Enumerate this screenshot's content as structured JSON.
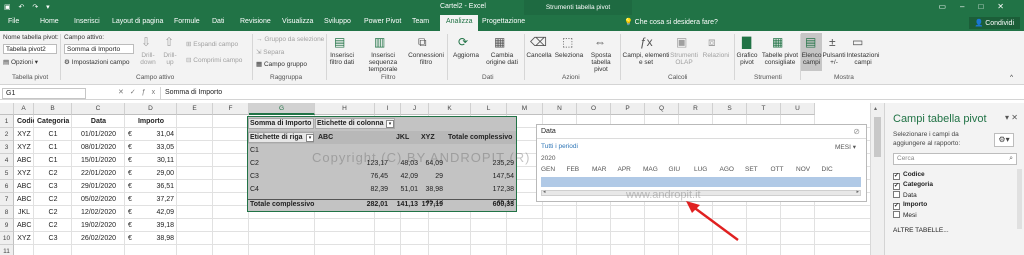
{
  "app": {
    "document_title": "Cartel2 - Excel",
    "contextual_tab_group": "Strumenti tabella pivot",
    "tell_me": "Che cosa si desidera fare?",
    "share": "Condividi",
    "accent": "#217346"
  },
  "tabs": [
    "File",
    "Home",
    "Inserisci",
    "Layout di pagina",
    "Formule",
    "Dati",
    "Revisione",
    "Visualizza",
    "Sviluppo",
    "Power Pivot",
    "Team",
    "Analizza",
    "Progettazione"
  ],
  "active_tab": "Analizza",
  "ribbon": {
    "pivot_name_label": "Nome tabella pivot:",
    "pivot_name_value": "Tabella pivot2",
    "options": "Opzioni",
    "active_field_label": "Campo attivo:",
    "active_field_value": "Somma di Importo",
    "field_settings": "Impostazioni campo",
    "drill_down": "Drill-down",
    "drill_up": "Drill-up",
    "expand_field": "Espandi campo",
    "collapse_field": "Comprimi campo",
    "group_selection": "Gruppo da selezione",
    "ungroup": "Separa",
    "group_field": "Campo gruppo",
    "insert_slicer": "Inserisci filtro dati",
    "insert_timeline": "Inserisci sequenza temporale",
    "filter_connections": "Connessioni filtro",
    "refresh": "Aggiorna",
    "change_source": "Cambia origine dati",
    "clear": "Cancella",
    "select": "Seleziona",
    "move_pivot": "Sposta tabella pivot",
    "fields_items_sets": "Campi, elementi e set",
    "olap_tools": "Strumenti OLAP",
    "relationships": "Relazioni",
    "pivot_chart": "Grafico pivot",
    "recommended_pivot": "Tabelle pivot consigliate",
    "field_list": "Elenco campi",
    "buttons_pm": "Pulsanti +/-",
    "field_headers": "Intestazioni campi",
    "groups": [
      "Tabella pivot",
      "Campo attivo",
      "Raggruppa",
      "Filtro",
      "Dati",
      "Azioni",
      "Calcoli",
      "Strumenti",
      "Mostra"
    ]
  },
  "formula_bar": {
    "name_box": "G1",
    "content": "Somma di Importo"
  },
  "columns": [
    "A",
    "B",
    "C",
    "D",
    "E",
    "F",
    "G",
    "H",
    "I",
    "J",
    "K",
    "L",
    "M",
    "N",
    "O",
    "P",
    "Q",
    "R",
    "S",
    "T",
    "U"
  ],
  "rows": [
    "1",
    "2",
    "3",
    "4",
    "5",
    "6",
    "7",
    "8",
    "9",
    "10",
    "11"
  ],
  "source_table": {
    "headers": [
      "Codice",
      "Categoria",
      "Data",
      "Importo"
    ],
    "rows": [
      [
        "XYZ",
        "C1",
        "01/01/2020",
        "€",
        "31,04"
      ],
      [
        "XYZ",
        "C1",
        "08/01/2020",
        "€",
        "33,05"
      ],
      [
        "ABC",
        "C1",
        "15/01/2020",
        "€",
        "30,11"
      ],
      [
        "XYZ",
        "C2",
        "22/01/2020",
        "€",
        "29,00"
      ],
      [
        "ABC",
        "C3",
        "29/01/2020",
        "€",
        "36,51"
      ],
      [
        "ABC",
        "C2",
        "05/02/2020",
        "€",
        "37,27"
      ],
      [
        "JKL",
        "C2",
        "12/02/2020",
        "€",
        "42,09"
      ],
      [
        "ABC",
        "C2",
        "19/02/2020",
        "€",
        "39,18"
      ],
      [
        "XYZ",
        "C3",
        "26/02/2020",
        "€",
        "38,98"
      ]
    ]
  },
  "pivot": {
    "value_field": "Somma di Importo",
    "column_labels": "Etichette di colonna",
    "row_labels": "Etichette di riga",
    "col_headers": [
      "ABC",
      "JKL",
      "XYZ",
      "Totale complessivo"
    ],
    "rows": [
      {
        "label": "C1",
        "abc": "",
        "jkl": "",
        "xyz": "",
        "total": ""
      },
      {
        "label": "C2",
        "abc": "123,17",
        "jkl": "48,03",
        "xyz": "64,09",
        "total": "235,29"
      },
      {
        "label": "C3",
        "abc": "76,45",
        "jkl": "42,09",
        "xyz": "29",
        "total": "147,54"
      },
      {
        "label": "C4",
        "abc": "82,39",
        "jkl": "51,01",
        "xyz": "38,98",
        "total": "172,38"
      },
      {
        "label": "",
        "abc": "",
        "jkl": "",
        "xyz": "45,12",
        "total": "45,12"
      }
    ],
    "grand_total": {
      "label": "Totale complessivo",
      "abc": "282,01",
      "jkl": "141,13",
      "xyz": "177,19",
      "total": "600,33"
    }
  },
  "timeline": {
    "title": "Data",
    "all_periods": "Tutti i periodi",
    "level": "MESI",
    "year": "2020",
    "months": [
      "GEN",
      "FEB",
      "MAR",
      "APR",
      "MAG",
      "GIU",
      "LUG",
      "AGO",
      "SET",
      "OTT",
      "NOV",
      "DIC"
    ]
  },
  "watermark": {
    "line1": "Copyright (C) BY ANDROPIT (R)",
    "line2": "www.andropit.it"
  },
  "field_pane": {
    "title": "Campi tabella pivot",
    "subtitle": "Selezionare i campi da aggiungere al rapporto:",
    "search_placeholder": "Cerca",
    "fields": [
      {
        "name": "Codice",
        "checked": true
      },
      {
        "name": "Categoria",
        "checked": true
      },
      {
        "name": "Data",
        "checked": false
      },
      {
        "name": "Importo",
        "checked": true
      },
      {
        "name": "Mesi",
        "checked": false
      }
    ],
    "more_tables": "ALTRE TABELLE..."
  }
}
